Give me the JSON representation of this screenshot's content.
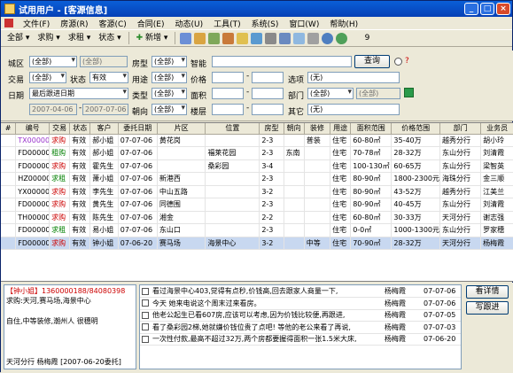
{
  "window": {
    "title": "试用用户 - [客源信息]",
    "min": "_",
    "max": "□",
    "close": "×"
  },
  "menu": [
    "文件(F)",
    "房源(R)",
    "客源(C)",
    "合同(E)",
    "动态(U)",
    "工具(T)",
    "系统(S)",
    "窗口(W)",
    "帮助(H)"
  ],
  "toolbar": {
    "all": "全部",
    "req": "求购",
    "group": "求租",
    "status": "状态",
    "add": "新增",
    "count": "9"
  },
  "filter": {
    "row1": {
      "region_label": "城区",
      "region_value": "(全部)",
      "region_value2": "(全部)",
      "house_type_label": "房型",
      "house_type_value": "(全部)",
      "smart_label": "智能",
      "smart_value": "",
      "query_button": "查询"
    },
    "row2": {
      "trade_label": "交易",
      "trade_value": "(全部)",
      "status_label": "状态",
      "status_value": "有效",
      "use_label": "用途",
      "use_value": "(全部)",
      "price_label": "价格",
      "price_from": "",
      "price_to": "",
      "options_label": "选项",
      "options_value": "(无)"
    },
    "row3": {
      "date_label": "日期",
      "date_value": "最后跟进日期",
      "type_label": "类型",
      "type_value": "(全部)",
      "area_label": "面积",
      "area_from": "",
      "area_to": "",
      "dept_label": "部门",
      "dept_value": "(全部)",
      "dept_value2": "(全部)"
    },
    "row4": {
      "date_from": "2007-04-06",
      "date_to": "2007-07-06",
      "orient_label": "朝向",
      "orient_value": "(全部)",
      "floor_label": "楼层",
      "floor_from": "",
      "floor_to": "",
      "other_label": "其它",
      "other_value": "(无)"
    }
  },
  "grid": {
    "headers": [
      "#",
      "编号",
      "交易",
      "状态",
      "客户",
      "委托日期",
      "片区",
      "位置",
      "房型",
      "朝向",
      "装修",
      "用途",
      "面积范围",
      "价格范围",
      "部门",
      "业务员"
    ],
    "rows": [
      [
        "",
        "TX000002",
        "求购",
        "有效",
        "郝小姐",
        "07-07-06",
        "黄花岗",
        "",
        "2-3",
        "",
        "普装",
        "住宅",
        "60-80㎡",
        "35-40万",
        "越秀分行",
        "胡小玲"
      ],
      [
        "",
        "FD000003",
        "租购",
        "有效",
        "郝小姐",
        "07-07-06",
        "",
        "福莱花园",
        "2-3",
        "东南",
        "",
        "住宅",
        "70-78㎡",
        "28-32万",
        "东山分行",
        "刘清霞"
      ],
      [
        "",
        "FD000004",
        "求购",
        "有效",
        "霍先生",
        "07-07-06",
        "",
        "桑彩园",
        "3-4",
        "",
        "",
        "住宅",
        "100-130㎡",
        "60-65万",
        "东山分行",
        "梁智英"
      ],
      [
        "",
        "HZ000001",
        "求租",
        "有效",
        "萧小姐",
        "07-07-06",
        "新港西",
        "",
        "2-3",
        "",
        "",
        "住宅",
        "80-90㎡",
        "1800-2300元",
        "海珠分行",
        "金三顺"
      ],
      [
        "",
        "YX000001",
        "求购",
        "有效",
        "李先生",
        "07-07-06",
        "中山五路",
        "",
        "3-2",
        "",
        "",
        "住宅",
        "80-90㎡",
        "43-52万",
        "越秀分行",
        "江美兰"
      ],
      [
        "",
        "FD000002",
        "求购",
        "有效",
        "黄先生",
        "07-07-06",
        "同德围",
        "",
        "2-3",
        "",
        "",
        "住宅",
        "80-90㎡",
        "40-45万",
        "东山分行",
        "刘清霞"
      ],
      [
        "",
        "TH000001",
        "求购",
        "有效",
        "陈先生",
        "07-07-06",
        "湘金",
        "",
        "2-2",
        "",
        "",
        "住宅",
        "60-80㎡",
        "30-33万",
        "天河分行",
        "谢志强"
      ],
      [
        "",
        "FD000005",
        "求租",
        "有效",
        "易小姐",
        "07-07-06",
        "东山口",
        "",
        "2-3",
        "",
        "",
        "住宅",
        "0-0㎡",
        "1000-1300元",
        "东山分行",
        "罗家穗"
      ],
      [
        "",
        "FD000001",
        "求购",
        "有效",
        "钟小姐",
        "07-06-20",
        "赛马场",
        "海景中心",
        "3-2",
        "",
        "中等",
        "住宅",
        "70-90㎡",
        "28-32万",
        "天河分行",
        "杨梅霞"
      ]
    ],
    "selected": 8
  },
  "info": {
    "line1": "【钟小姐】1360000188/84080398",
    "line2": "求购:天河,赛马场,海景中心",
    "line3": "自住,中等装修,潮州人 很穗明",
    "line4": "天河分行 杨梅霞 [2007-06-20委托]"
  },
  "tracks": [
    {
      "text": "看过海景中心403,觉得有点秒,价钱高,回去跟家人商量一下,",
      "agent": "杨梅霞",
      "date": "07-07-06"
    },
    {
      "text": "今天 她来电说这个周末过来看房。",
      "agent": "杨梅霞",
      "date": "07-07-06"
    },
    {
      "text": "他老公起生已看607房,应该可以考虑,因为价钱比较便,再跟进,",
      "agent": "杨梅霞",
      "date": "07-07-05"
    },
    {
      "text": "看了桑彩园2梯,她就嫌价钱位贵了点吧! 等他的老公来看了再说,",
      "agent": "杨梅霞",
      "date": "07-07-03"
    },
    {
      "text": "一次性付款,最高不超过32万,两个房都要握得面积一张1.5米大床,",
      "agent": "杨梅霞",
      "date": "07-06-20"
    }
  ],
  "buttons": {
    "details": "看详情",
    "follow": "写跟进"
  },
  "colors": {
    "title_bar": "#0a5fd8",
    "highlight": "#c8d8f0",
    "trade_red": "#cc0000",
    "trade_green": "#008000",
    "id_purple": "#9933cc"
  }
}
